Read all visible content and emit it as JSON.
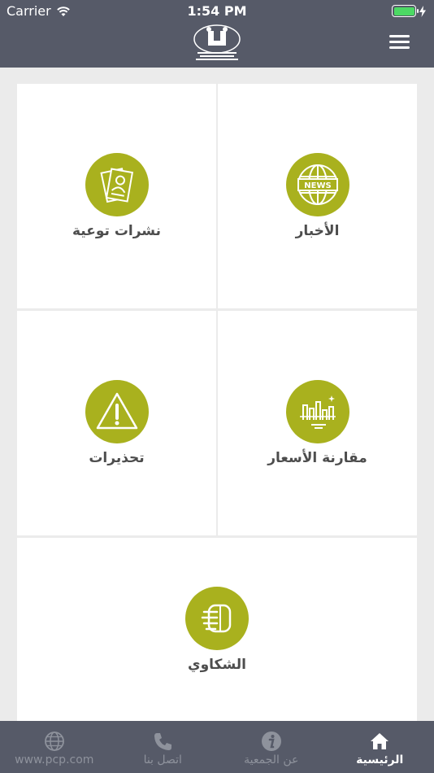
{
  "status_bar": {
    "carrier": "Carrier",
    "time": "1:54 PM"
  },
  "header": {
    "logo_name": "pcp-logo",
    "menu_icon": "hamburger-icon"
  },
  "cards": {
    "news": {
      "label": "الأخبار",
      "icon": "news-globe-icon",
      "icon_text": "NEWS"
    },
    "bulletins": {
      "label": "نشرات توعية",
      "icon": "bulletin-papers-icon"
    },
    "prices": {
      "label": "مقارنة الأسعار",
      "icon": "price-chart-icon"
    },
    "warnings": {
      "label": "تحذيرات",
      "icon": "warning-triangle-icon"
    },
    "complaints": {
      "label": "الشكاوي",
      "icon": "complaint-hand-icon"
    }
  },
  "tabbar": {
    "website": {
      "label": "www.pcp.com",
      "icon": "globe-icon"
    },
    "contact": {
      "label": "اتصل بنا",
      "icon": "phone-icon"
    },
    "about": {
      "label": "عن الجمعية",
      "icon": "info-icon"
    },
    "home": {
      "label": "الرئيسية",
      "icon": "home-icon"
    }
  },
  "colors": {
    "header_bg": "#565a68",
    "accent": "#a9b11e",
    "page_bg": "#ebebeb"
  }
}
